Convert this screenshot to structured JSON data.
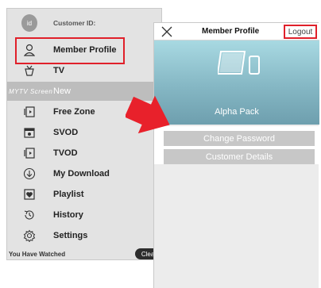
{
  "sidebar": {
    "customer_id_label": "Customer ID:",
    "id_badge": "id",
    "items": [
      {
        "label": "Member Profile",
        "icon": "person-icon"
      },
      {
        "label": "TV",
        "icon": "tv-icon"
      },
      {
        "label": "New",
        "icon": "brand-logo"
      },
      {
        "label": "Free Zone",
        "icon": "play-icon"
      },
      {
        "label": "SVOD",
        "icon": "calendar-icon"
      },
      {
        "label": "TVOD",
        "icon": "play-icon"
      },
      {
        "label": "My Download",
        "icon": "download-icon"
      },
      {
        "label": "Playlist",
        "icon": "heart-icon"
      },
      {
        "label": "History",
        "icon": "history-icon"
      },
      {
        "label": "Settings",
        "icon": "gear-icon"
      }
    ],
    "watched_label": "You Have Watched",
    "clear_label": "Clear"
  },
  "detail": {
    "title": "Member Profile",
    "logout_label": "Logout",
    "pack_name": "Alpha Pack",
    "change_password_label": "Change Password",
    "customer_details_label": "Customer Details"
  },
  "colors": {
    "highlight": "#e0202a",
    "sidebar_bg": "#e3e3e3",
    "hero_top": "#a8d9e2",
    "button_gray": "#c7c7c7"
  }
}
